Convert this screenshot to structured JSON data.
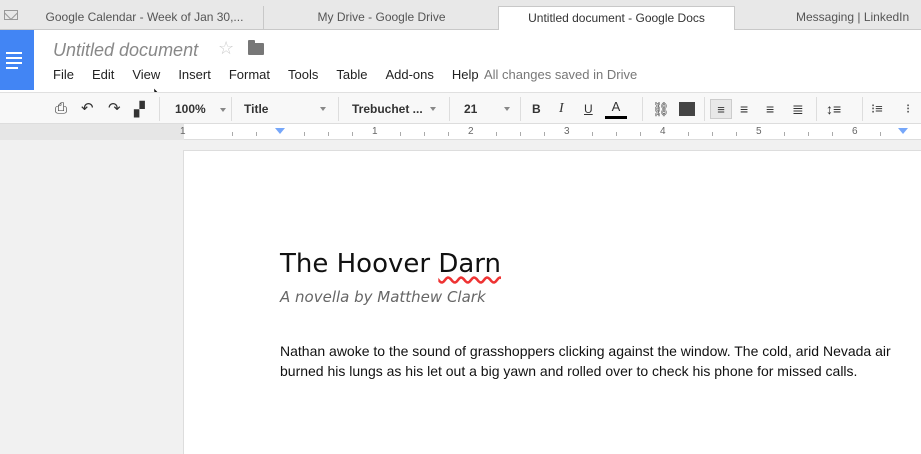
{
  "tabs": [
    {
      "label": "Google Calendar - Week of Jan 30,..."
    },
    {
      "label": "My Drive - Google Drive"
    },
    {
      "label": "Untitled document - Google Docs"
    },
    {
      "label": "Messaging | LinkedIn"
    }
  ],
  "doc": {
    "title": "Untitled document",
    "saved": "All changes saved in Drive"
  },
  "menu": [
    "File",
    "Edit",
    "View",
    "Insert",
    "Format",
    "Tools",
    "Table",
    "Add-ons",
    "Help"
  ],
  "toolbar": {
    "zoom": "100%",
    "style": "Title",
    "font": "Trebuchet ...",
    "size": "21"
  },
  "ruler": {
    "numbers": [
      "1",
      "1",
      "2",
      "3",
      "4",
      "5",
      "6"
    ]
  },
  "content": {
    "heading_pre": "The Hoover ",
    "heading_misspelled": "Darn",
    "subtitle": "A novella by Matthew Clark",
    "paragraph": "Nathan awoke to the sound of grasshoppers clicking against the window.  The cold, arid Nevada air burned his lungs as his let out a big yawn and rolled over to check his phone for missed calls."
  }
}
